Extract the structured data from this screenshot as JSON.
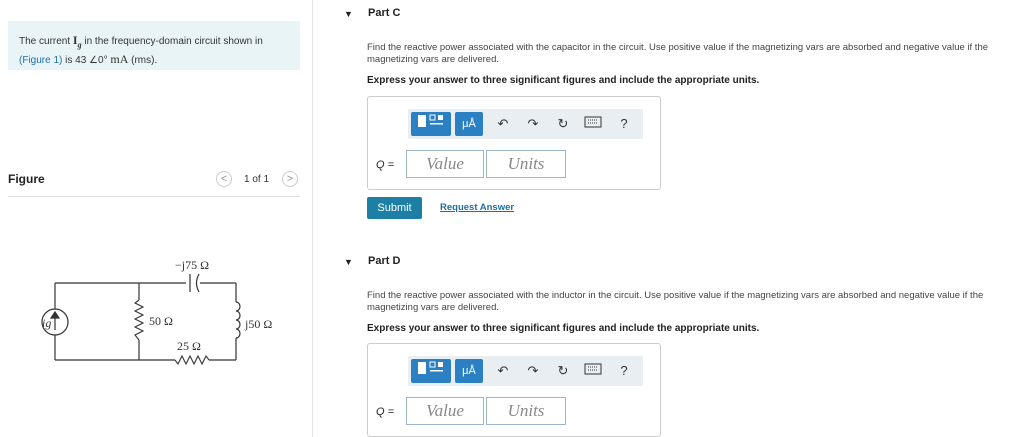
{
  "problem": {
    "intro_prefix": "The current",
    "current_symbol": "I",
    "current_subscript": "g",
    "intro_middle": "in the frequency-domain circuit shown in",
    "figure_link": "(Figure 1)",
    "intro_is": "is 43",
    "angle_symbol": "∠",
    "angle_value": "0°",
    "unit_mA": "mA",
    "rms": "(rms)."
  },
  "figure": {
    "title": "Figure",
    "pager_label": "1 of 1",
    "prev_symbol": "<",
    "next_symbol": ">",
    "circuit_labels": {
      "source": "ig",
      "capacitor": "−j75 Ω",
      "r1": "50 Ω",
      "r2": "25 Ω",
      "inductor": "j50 Ω"
    }
  },
  "parts": [
    {
      "label": "Part C",
      "question": "Find the reactive power associated with the capacitor in the circuit. Use positive value if the magnetizing vars are absorbed and negative value if the magnetizing vars are delivered.",
      "instruction": "Express your answer to three significant figures and include the appropriate units.",
      "q_label": "Q =",
      "value_placeholder": "Value",
      "units_placeholder": "Units",
      "submit_label": "Submit",
      "request_label": "Request Answer"
    },
    {
      "label": "Part D",
      "question": "Find the reactive power associated with the inductor in the circuit. Use positive value if the magnetizing vars are absorbed and negative value if the magnetizing vars are delivered.",
      "instruction": "Express your answer to three significant figures and include the appropriate units.",
      "q_label": "Q =",
      "value_placeholder": "Value",
      "units_placeholder": "Units"
    }
  ],
  "toolbar": {
    "templates_icon": "templates-icon",
    "units_label": "μÅ",
    "undo_icon": "undo-icon",
    "redo_icon": "redo-icon",
    "reset_icon": "reset-icon",
    "keyboard_icon": "keyboard-icon",
    "help_label": "?"
  },
  "colors": {
    "accent": "#2a80c2",
    "submit": "#1e7fa6",
    "link": "#1e6fa8",
    "intro_bg": "#e8f4f6"
  }
}
